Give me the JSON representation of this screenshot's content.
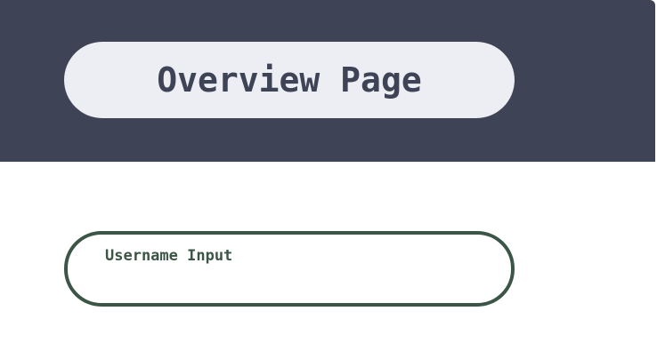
{
  "header": {
    "title": "Overview Page"
  },
  "form": {
    "username": {
      "label": "Username Input",
      "value": "",
      "placeholder": ""
    }
  },
  "colors": {
    "header_bg": "#3e4355",
    "title_pill_bg": "#eceef3",
    "field_border": "#3b5546"
  }
}
